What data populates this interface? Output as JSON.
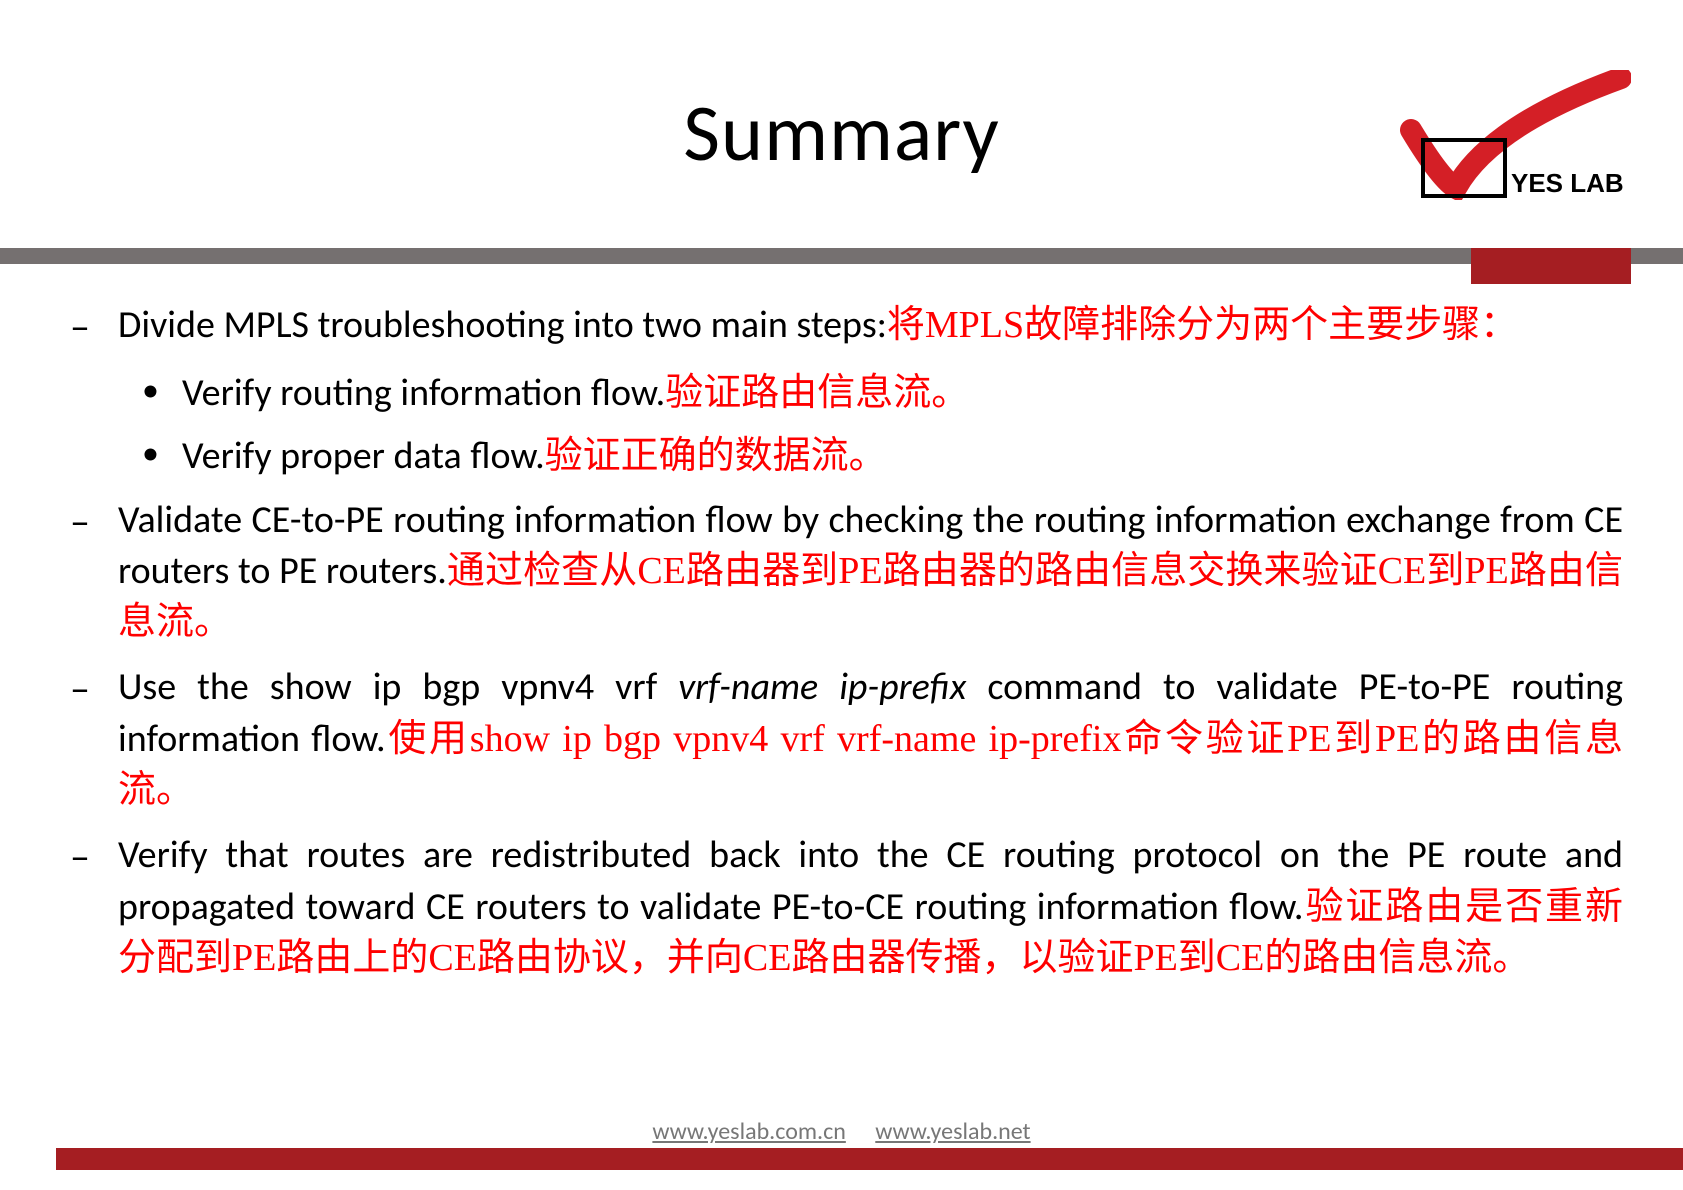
{
  "title": "Summary",
  "logo_text": "YES LAB",
  "bullets": {
    "b1_en": "Divide MPLS troubleshooting into two main steps:",
    "b1_zh": "将MPLS故障排除分为两个主要步骤：",
    "b1_s1_en": "Verify routing information flow.",
    "b1_s1_zh": "验证路由信息流。",
    "b1_s2_en": "Verify proper data flow.",
    "b1_s2_zh": "验证正确的数据流。",
    "b2_en": "Validate CE-to-PE routing information flow by checking the  routing information exchange from CE routers to PE routers.",
    "b2_zh": "通过检查从CE路由器到PE路由器的路由信息交换来验证CE到PE路由信息流。",
    "b3_en_a": "Use the show ip bgp vpnv4 vrf ",
    "b3_en_ital": "vrf-name ip-prefix",
    "b3_en_b": " command  to validate PE-to-PE routing information flow.",
    "b3_zh": "使用show ip bgp vpnv4 vrf vrf-name ip-prefix命令验证PE到PE的路由信息流。",
    "b4_en": "Verify that routes are redistributed back into the CE routing  protocol on the PE route and propagated toward CE routers  to validate PE-to-CE routing information flow.",
    "b4_zh": "验证路由是否重新分配到PE路由上的CE路由协议，并向CE路由器传播，以验证PE到CE的路由信息流。"
  },
  "footer": {
    "url1": "www.yeslab.com.cn",
    "url2": "www.yeslab.net"
  }
}
